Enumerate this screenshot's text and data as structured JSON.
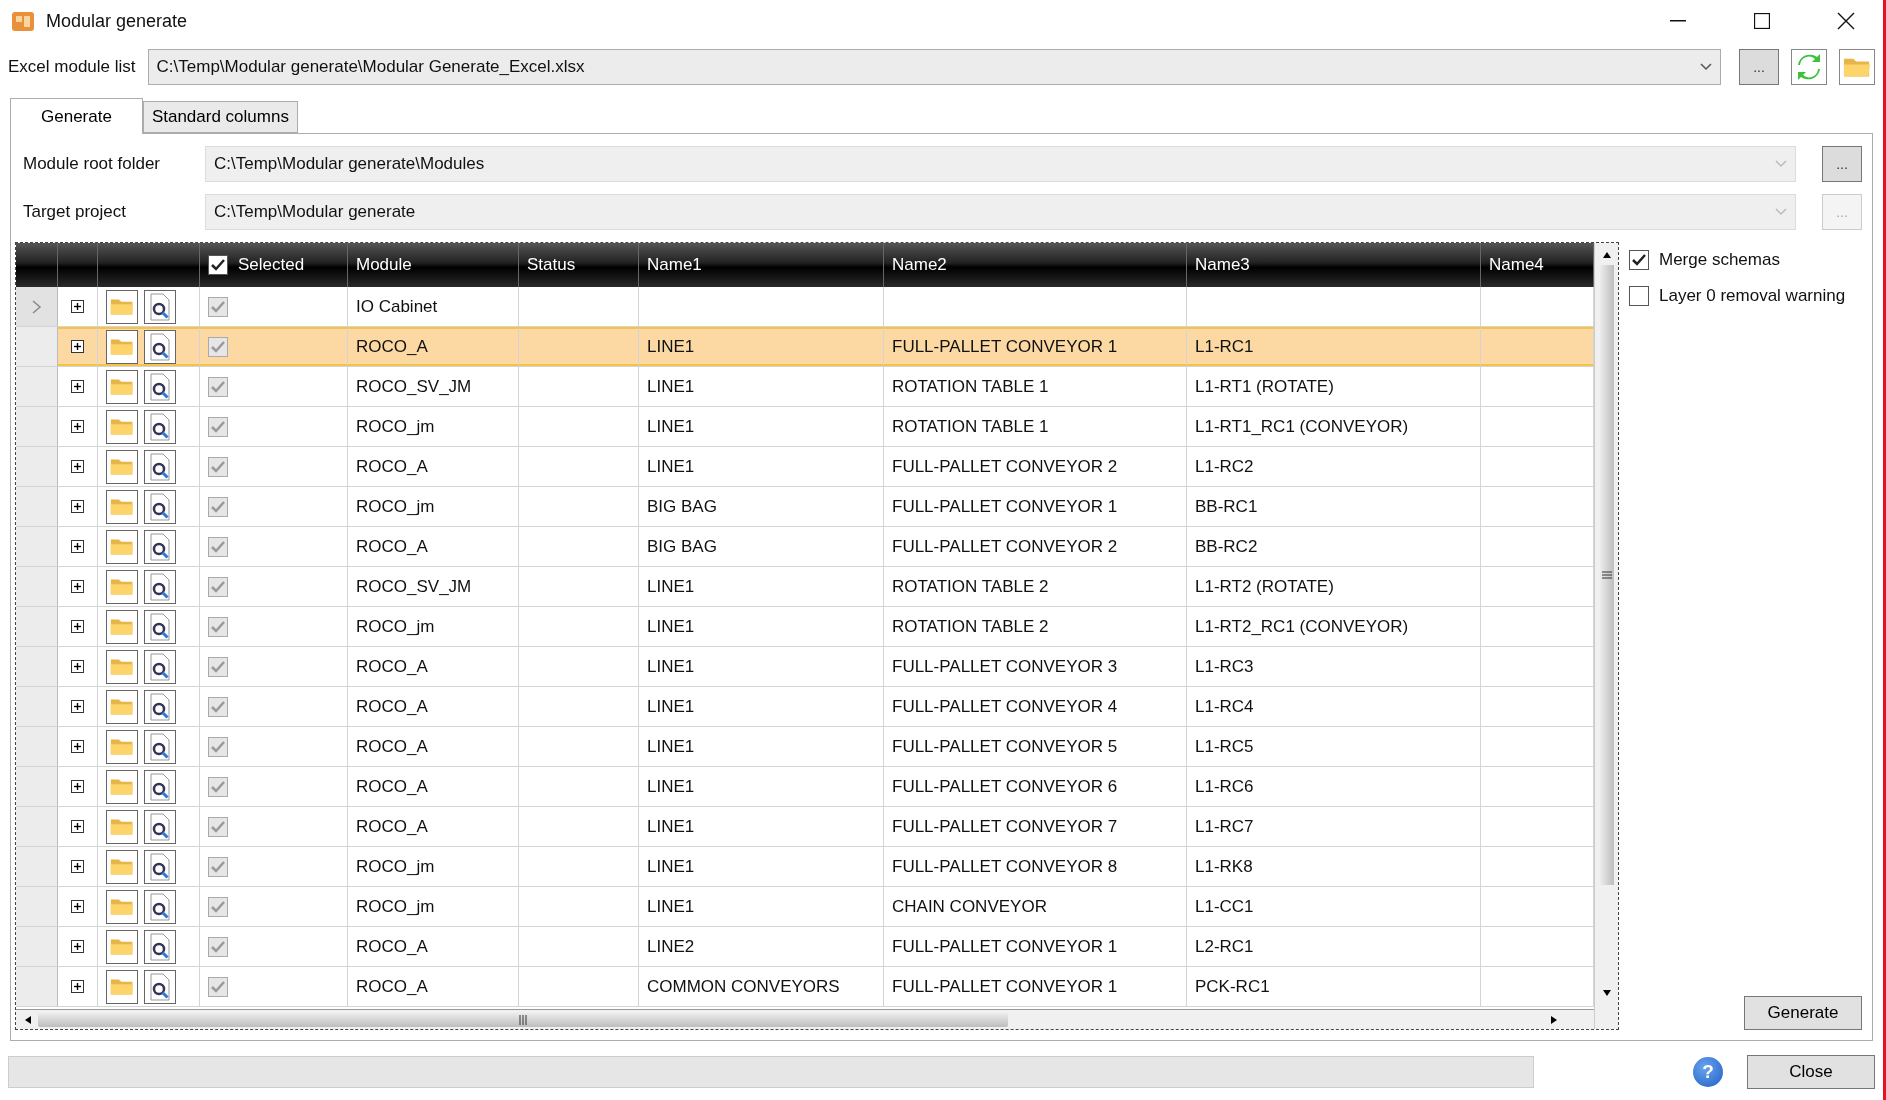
{
  "window": {
    "title": "Modular generate"
  },
  "excel_module_list": {
    "label": "Excel module list",
    "value": "C:\\Temp\\Modular generate\\Modular Generate_Excel.xlsx",
    "browse": "..."
  },
  "tabs": [
    {
      "label": "Generate",
      "selected": true
    },
    {
      "label": "Standard columns",
      "selected": false
    }
  ],
  "module_root_folder": {
    "label": "Module root folder",
    "value": "C:\\Temp\\Modular generate\\Modules",
    "browse": {
      "label": "...",
      "disabled": false
    }
  },
  "target_project": {
    "label": "Target project",
    "value": "C:\\Temp\\Modular generate",
    "browse": {
      "label": "...",
      "disabled": true
    }
  },
  "table": {
    "selected_header": {
      "label": "Selected",
      "checked": true
    },
    "columns": [
      "Module",
      "Status",
      "Name1",
      "Name2",
      "Name3",
      "Name4"
    ],
    "rows": [
      {
        "current": true,
        "selected": false,
        "expanded": false,
        "checked": true,
        "module": "IO Cabinet"
      },
      {
        "current": false,
        "selected": true,
        "expanded": false,
        "checked": true,
        "module": "ROCO_A",
        "name1": "LINE1",
        "name2": "FULL-PALLET CONVEYOR 1",
        "name3": "L1-RC1"
      },
      {
        "current": false,
        "selected": false,
        "expanded": false,
        "checked": true,
        "module": "ROCO_SV_JM",
        "name1": "LINE1",
        "name2": "ROTATION TABLE 1",
        "name3": "L1-RT1 (ROTATE)"
      },
      {
        "current": false,
        "selected": false,
        "expanded": false,
        "checked": true,
        "module": "ROCO_jm",
        "name1": "LINE1",
        "name2": "ROTATION TABLE 1",
        "name3": "L1-RT1_RC1 (CONVEYOR)"
      },
      {
        "current": false,
        "selected": false,
        "expanded": false,
        "checked": true,
        "module": "ROCO_A",
        "name1": "LINE1",
        "name2": "FULL-PALLET CONVEYOR 2",
        "name3": "L1-RC2"
      },
      {
        "current": false,
        "selected": false,
        "expanded": false,
        "checked": true,
        "module": "ROCO_jm",
        "name1": "BIG BAG",
        "name2": "FULL-PALLET CONVEYOR 1",
        "name3": "BB-RC1"
      },
      {
        "current": false,
        "selected": false,
        "expanded": false,
        "checked": true,
        "module": "ROCO_A",
        "name1": "BIG BAG",
        "name2": "FULL-PALLET CONVEYOR 2",
        "name3": "BB-RC2"
      },
      {
        "current": false,
        "selected": false,
        "expanded": false,
        "checked": true,
        "module": "ROCO_SV_JM",
        "name1": "LINE1",
        "name2": "ROTATION TABLE 2",
        "name3": "L1-RT2 (ROTATE)"
      },
      {
        "current": false,
        "selected": false,
        "expanded": false,
        "checked": true,
        "module": "ROCO_jm",
        "name1": "LINE1",
        "name2": "ROTATION TABLE 2",
        "name3": "L1-RT2_RC1 (CONVEYOR)"
      },
      {
        "current": false,
        "selected": false,
        "expanded": false,
        "checked": true,
        "module": "ROCO_A",
        "name1": "LINE1",
        "name2": "FULL-PALLET CONVEYOR 3",
        "name3": "L1-RC3"
      },
      {
        "current": false,
        "selected": false,
        "expanded": false,
        "checked": true,
        "module": "ROCO_A",
        "name1": "LINE1",
        "name2": "FULL-PALLET CONVEYOR 4",
        "name3": "L1-RC4"
      },
      {
        "current": false,
        "selected": false,
        "expanded": false,
        "checked": true,
        "module": "ROCO_A",
        "name1": "LINE1",
        "name2": "FULL-PALLET CONVEYOR 5",
        "name3": "L1-RC5"
      },
      {
        "current": false,
        "selected": false,
        "expanded": false,
        "checked": true,
        "module": "ROCO_A",
        "name1": "LINE1",
        "name2": "FULL-PALLET CONVEYOR 6",
        "name3": "L1-RC6"
      },
      {
        "current": false,
        "selected": false,
        "expanded": false,
        "checked": true,
        "module": "ROCO_A",
        "name1": "LINE1",
        "name2": "FULL-PALLET CONVEYOR 7",
        "name3": "L1-RC7"
      },
      {
        "current": false,
        "selected": false,
        "expanded": false,
        "checked": true,
        "module": "ROCO_jm",
        "name1": "LINE1",
        "name2": "FULL-PALLET CONVEYOR 8",
        "name3": "L1-RK8"
      },
      {
        "current": false,
        "selected": false,
        "expanded": false,
        "checked": true,
        "module": "ROCO_jm",
        "name1": "LINE1",
        "name2": "CHAIN CONVEYOR",
        "name3": "L1-CC1"
      },
      {
        "current": false,
        "selected": false,
        "expanded": false,
        "checked": true,
        "module": "ROCO_A",
        "name1": "LINE2",
        "name2": "FULL-PALLET CONVEYOR 1",
        "name3": "L2-RC1"
      },
      {
        "current": false,
        "selected": false,
        "expanded": false,
        "checked": true,
        "module": "ROCO_A",
        "name1": "COMMON CONVEYORS",
        "name2": "FULL-PALLET CONVEYOR 1",
        "name3": "PCK-RC1"
      }
    ]
  },
  "options": [
    {
      "label": "Merge schemas",
      "checked": true
    },
    {
      "label": "Layer 0 removal warning",
      "checked": false
    }
  ],
  "generate_button": "Generate",
  "progress": {
    "level": 0
  },
  "help_button": "?",
  "close_button": "Close"
}
